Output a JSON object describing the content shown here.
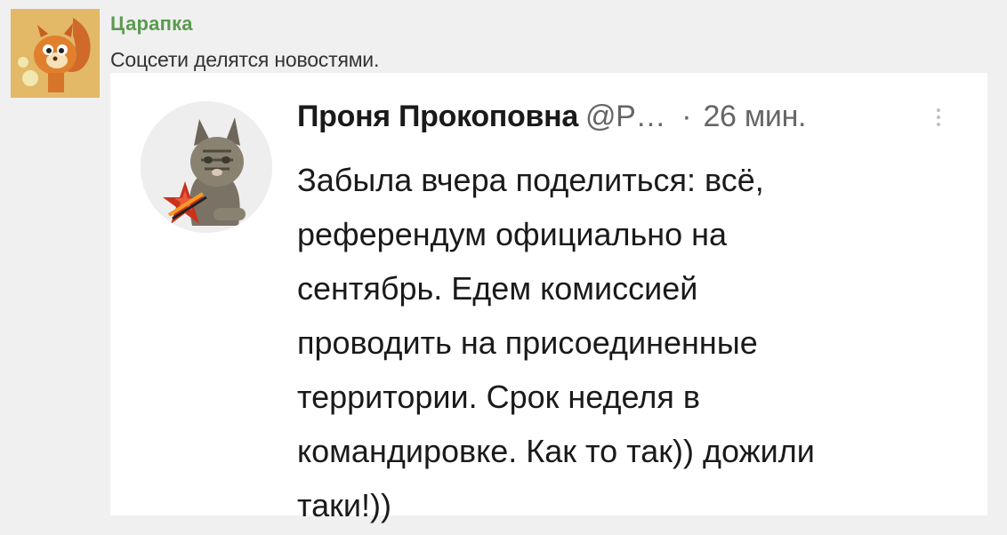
{
  "post": {
    "author": "Царапка",
    "subtitle": "Соцсети делятся новостями."
  },
  "tweet": {
    "author": "Проня Прокоповна",
    "handle": "@Р…",
    "separator": "·",
    "time": "26 мин.",
    "text_lines": [
      "Забыла вчера поделиться: всё,",
      "референдум официально на",
      "сентябрь. Едем комиссией",
      "проводить на присоединенные",
      "территории. Срок неделя в",
      "командировке. Как то так)) дожили",
      "таки!))"
    ]
  },
  "icons": {
    "poster_avatar": "cartoon-squirrel-avatar",
    "tweet_avatar": "cat-with-star-avatar",
    "more": "more-vertical-icon"
  },
  "colors": {
    "page_bg": "#f0f0f0",
    "poster_name": "#5a9a4e",
    "card_bg": "#ffffff",
    "star": "#c8321e"
  }
}
